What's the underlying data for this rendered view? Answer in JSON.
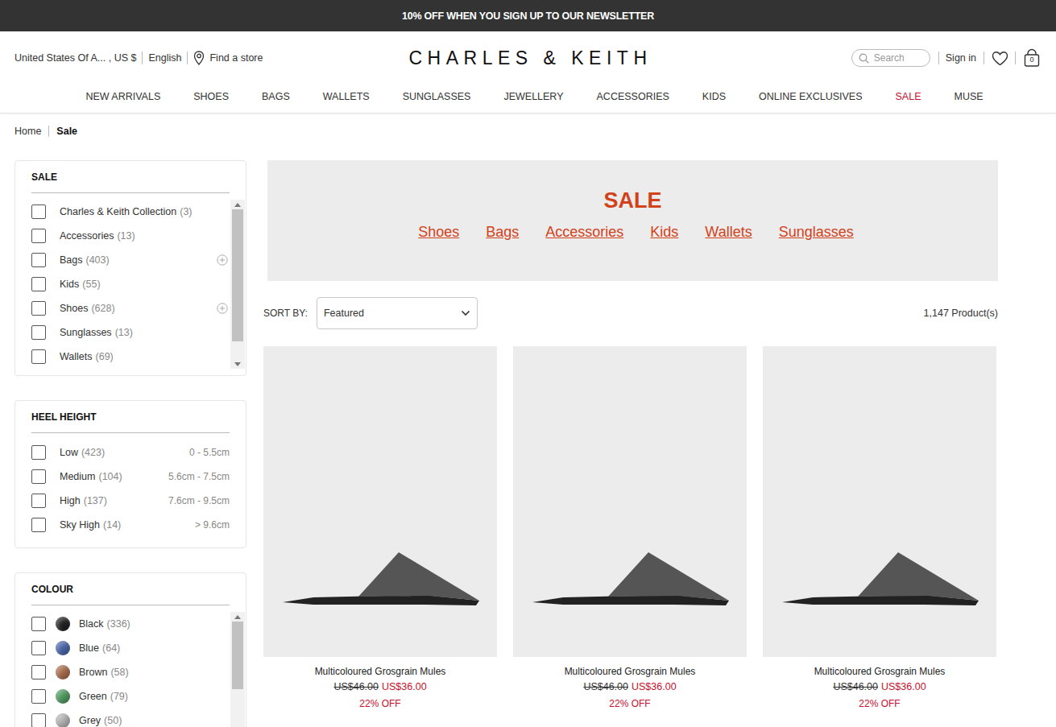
{
  "banner": {
    "text": "10% OFF WHEN YOU SIGN UP TO OUR NEWSLETTER"
  },
  "header": {
    "region": "United States Of A... , US $",
    "language": "English",
    "store_link": "Find a store",
    "logo": "CHARLES & KEITH",
    "search": {
      "placeholder": "Search"
    },
    "sign_in": "Sign in",
    "cart_count": "0"
  },
  "nav": [
    {
      "label": "NEW ARRIVALS",
      "selected": false
    },
    {
      "label": "SHOES",
      "selected": false
    },
    {
      "label": "BAGS",
      "selected": false
    },
    {
      "label": "WALLETS",
      "selected": false
    },
    {
      "label": "SUNGLASSES",
      "selected": false
    },
    {
      "label": "JEWELLERY",
      "selected": false
    },
    {
      "label": "ACCESSORIES",
      "selected": false
    },
    {
      "label": "KIDS",
      "selected": false
    },
    {
      "label": "ONLINE EXCLUSIVES",
      "selected": false
    },
    {
      "label": "SALE",
      "selected": true
    },
    {
      "label": "MUSE",
      "selected": false
    }
  ],
  "breadcrumb": [
    {
      "label": "Home",
      "current": false
    },
    {
      "label": "Sale",
      "current": true
    }
  ],
  "filters": {
    "sale": {
      "title": "SALE",
      "scrollbar_level": 0.88,
      "items": [
        {
          "label": "Charles & Keith Collection",
          "count": "(3)",
          "checked": false,
          "expandable": false
        },
        {
          "label": "Accessories",
          "count": "(13)",
          "checked": false,
          "expandable": false
        },
        {
          "label": "Bags",
          "count": "(403)",
          "checked": false,
          "expandable": true
        },
        {
          "label": "Kids",
          "count": "(55)",
          "checked": false,
          "expandable": false
        },
        {
          "label": "Shoes",
          "count": "(628)",
          "checked": false,
          "expandable": true
        },
        {
          "label": "Sunglasses",
          "count": "(13)",
          "checked": false,
          "expandable": false
        },
        {
          "label": "Wallets",
          "count": "(69)",
          "checked": false,
          "expandable": false
        }
      ]
    },
    "heel_height": {
      "title": "HEEL HEIGHT",
      "items": [
        {
          "label": "Low",
          "count": "(423)",
          "range": "0 - 5.5cm",
          "checked": false
        },
        {
          "label": "Medium",
          "count": "(104)",
          "range": "5.6cm - 7.5cm",
          "checked": false
        },
        {
          "label": "High",
          "count": "(137)",
          "range": "7.6cm - 9.5cm",
          "checked": false
        },
        {
          "label": "Sky High",
          "count": "(14)",
          "range": "> 9.6cm",
          "checked": false
        }
      ]
    },
    "colour": {
      "title": "COLOUR",
      "scrollbar_level": 0.45,
      "items": [
        {
          "label": "Black",
          "count": "(336)",
          "color": "#222222",
          "checked": false
        },
        {
          "label": "Blue",
          "count": "(64)",
          "color": "#4a66a8",
          "checked": false
        },
        {
          "label": "Brown",
          "count": "(58)",
          "color": "#a86c4c",
          "checked": false
        },
        {
          "label": "Green",
          "count": "(79)",
          "color": "#4f9a5f",
          "checked": false
        },
        {
          "label": "Grey",
          "count": "(50)",
          "color": "#b5b5b5",
          "checked": false
        }
      ]
    }
  },
  "sale_banner": {
    "title": "SALE",
    "links": [
      "Shoes",
      "Bags",
      "Accessories",
      "Kids",
      "Wallets",
      "Sunglasses"
    ]
  },
  "sort": {
    "label": "SORT BY:",
    "value": "Featured"
  },
  "product_count": "1,147 Product(s)",
  "products": [
    {
      "name": "Multicoloured Grosgrain Mules",
      "original_price": "US$46.00",
      "sale_price": "US$36.00",
      "discount": "22% OFF"
    },
    {
      "name": "Multicoloured Grosgrain Mules",
      "original_price": "US$46.00",
      "sale_price": "US$36.00",
      "discount": "22% OFF"
    },
    {
      "name": "Multicoloured Grosgrain Mules",
      "original_price": "US$46.00",
      "sale_price": "US$36.00",
      "discount": "22% OFF"
    }
  ]
}
